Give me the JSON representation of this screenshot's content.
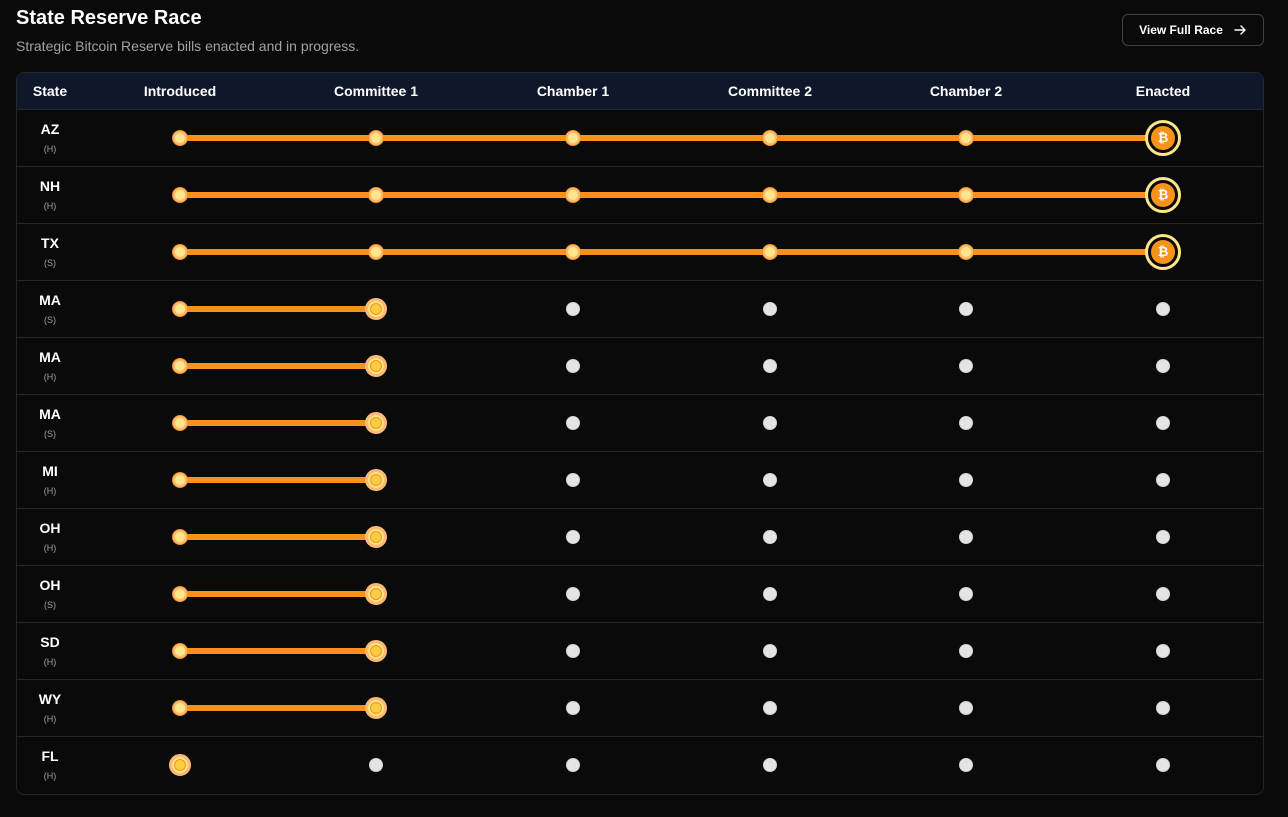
{
  "header": {
    "title": "State Reserve Race",
    "subtitle": "Strategic Bitcoin Reserve bills enacted and in progress.",
    "button_label": "View Full Race"
  },
  "colors": {
    "accent": "#f7931a",
    "inactive_dot": "#e4e4e7",
    "header_bg": "#0f172a",
    "page_bg": "#0a0a0a"
  },
  "icons": {
    "button_icon": "arrow-right-icon",
    "enacted_icon": "bitcoin-icon"
  },
  "table": {
    "columns": [
      "State",
      "Introduced",
      "Committee 1",
      "Chamber 1",
      "Committee 2",
      "Chamber 2",
      "Enacted"
    ],
    "enacted_symbol": "₿",
    "rows": [
      {
        "state": "AZ",
        "chamber": "(H)",
        "stage": 5
      },
      {
        "state": "NH",
        "chamber": "(H)",
        "stage": 5
      },
      {
        "state": "TX",
        "chamber": "(S)",
        "stage": 5
      },
      {
        "state": "MA",
        "chamber": "(S)",
        "stage": 1
      },
      {
        "state": "MA",
        "chamber": "(H)",
        "stage": 1
      },
      {
        "state": "MA",
        "chamber": "(S)",
        "stage": 1
      },
      {
        "state": "MI",
        "chamber": "(H)",
        "stage": 1
      },
      {
        "state": "OH",
        "chamber": "(H)",
        "stage": 1
      },
      {
        "state": "OH",
        "chamber": "(S)",
        "stage": 1
      },
      {
        "state": "SD",
        "chamber": "(H)",
        "stage": 1
      },
      {
        "state": "WY",
        "chamber": "(H)",
        "stage": 1
      },
      {
        "state": "FL",
        "chamber": "(H)",
        "stage": 0
      }
    ]
  }
}
